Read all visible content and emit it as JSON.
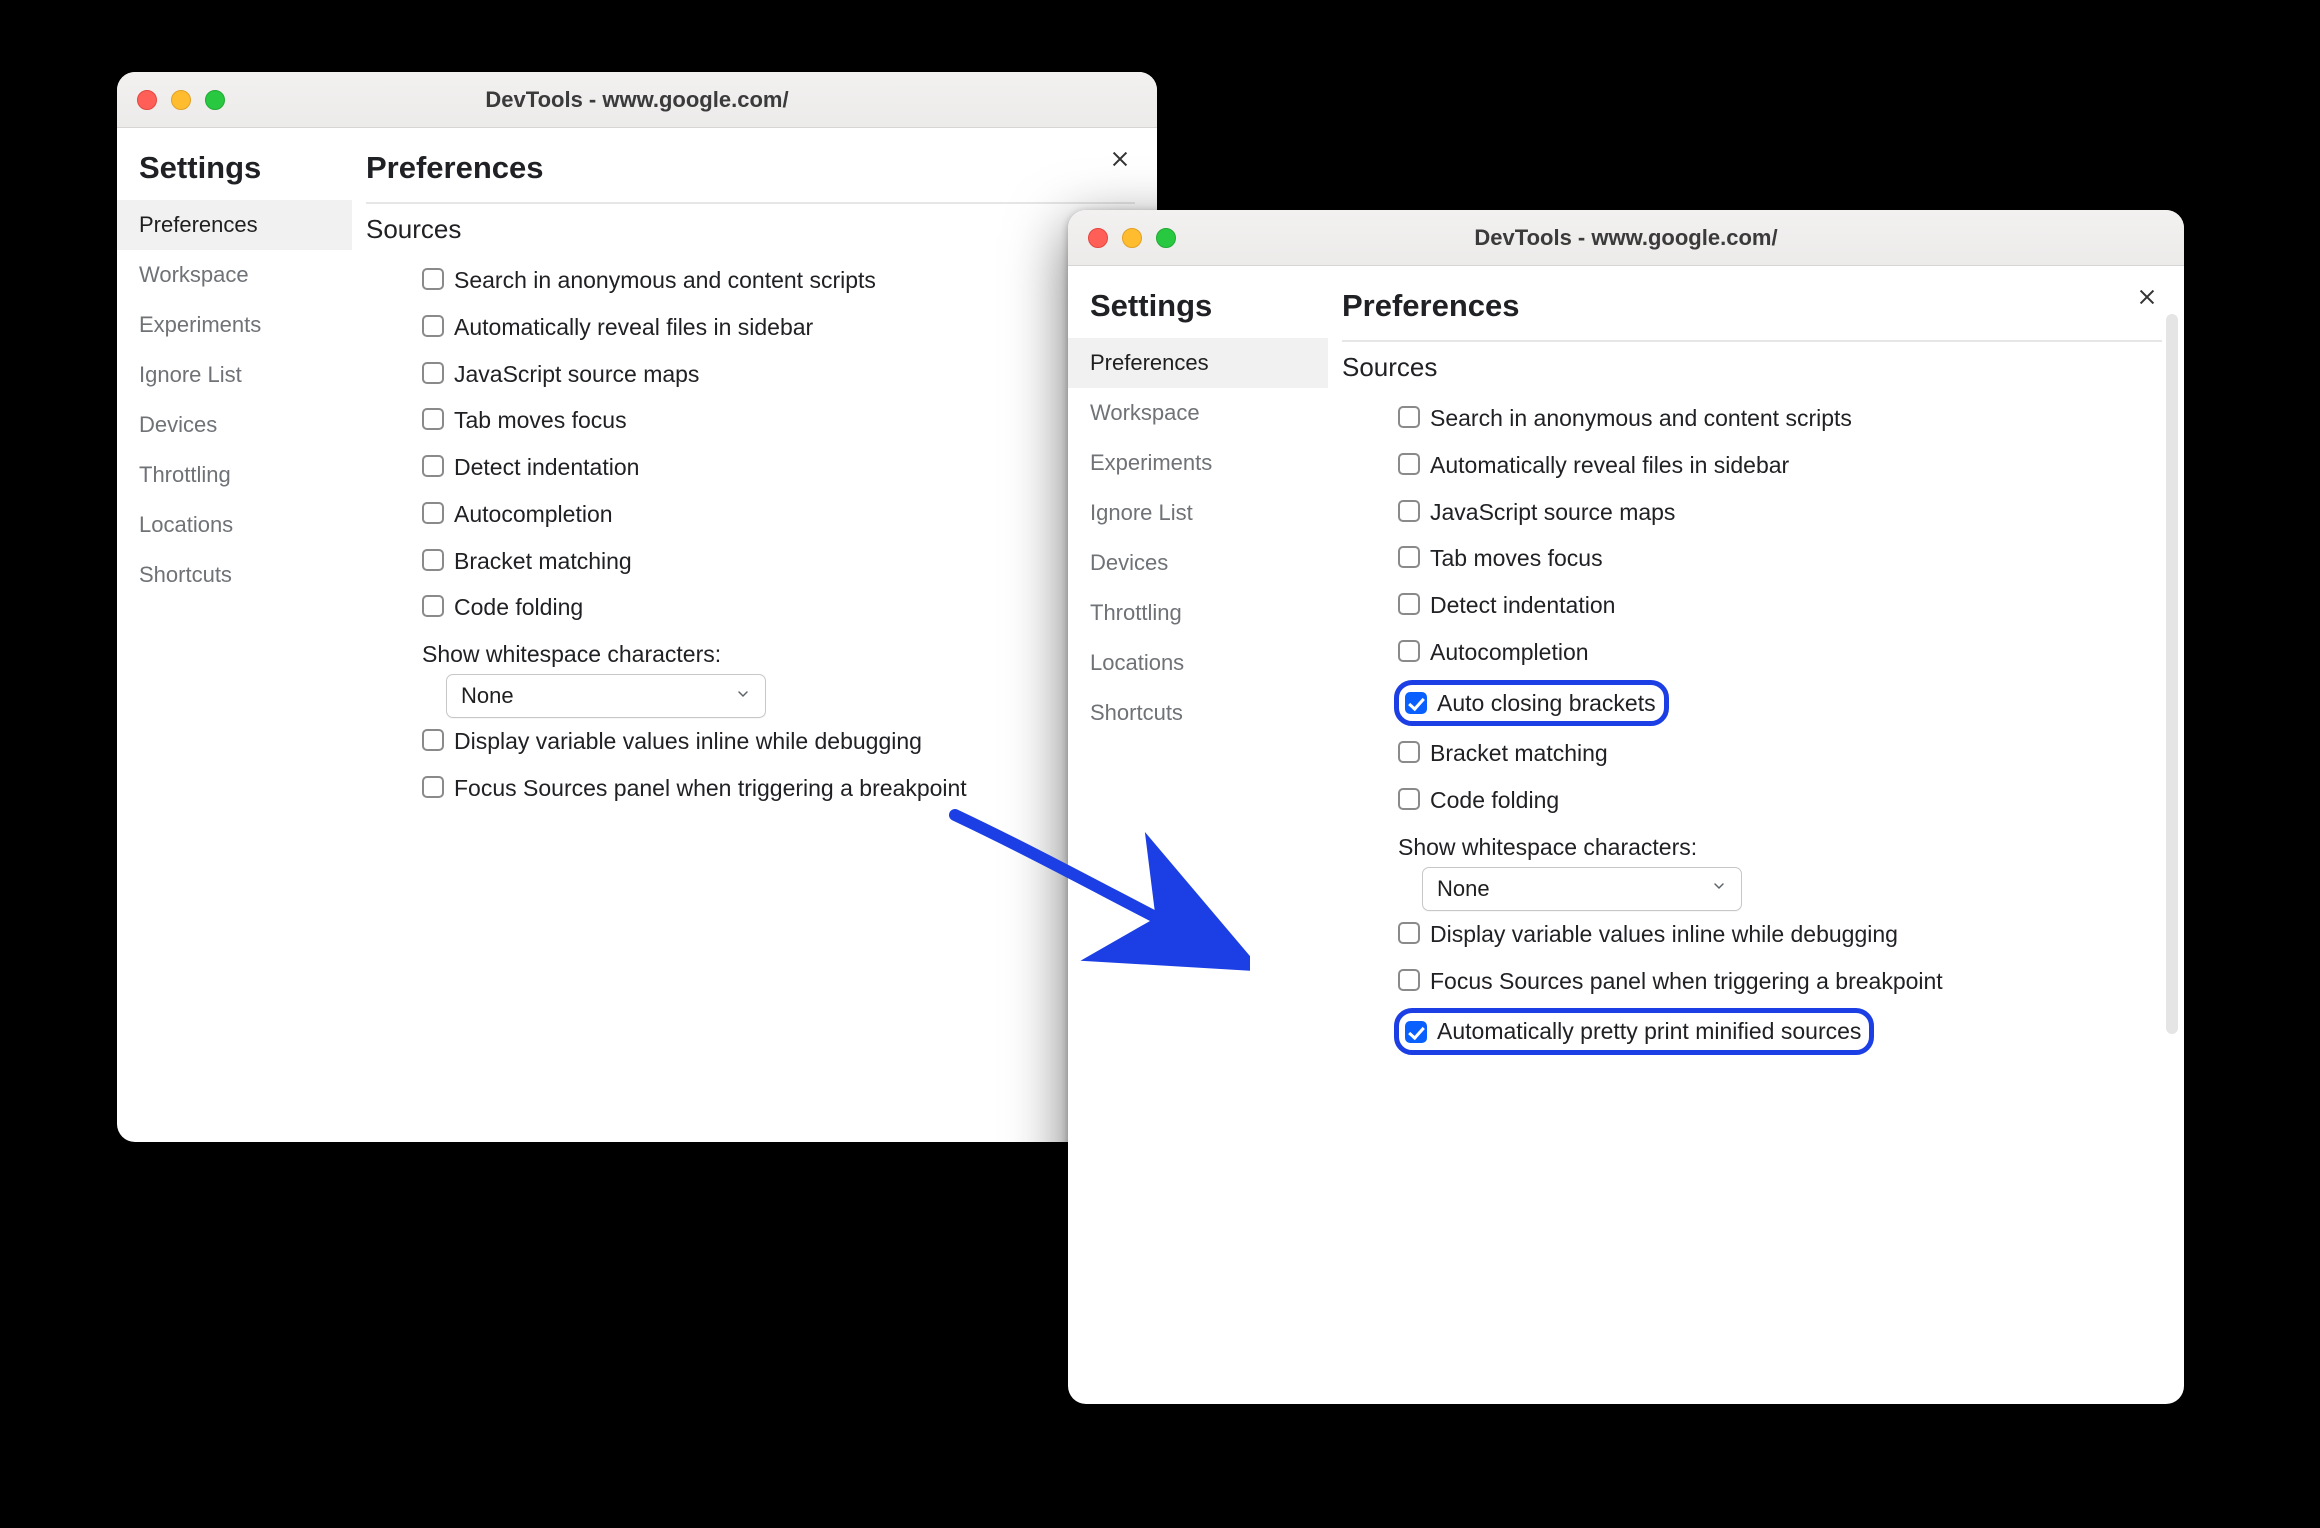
{
  "colors": {
    "highlight": "#1b3fe4",
    "checkbox_checked": "#0a60ff"
  },
  "windows": {
    "left": {
      "title": "DevTools - www.google.com/",
      "settings_heading": "Settings",
      "main_heading": "Preferences",
      "section_heading": "Sources",
      "sidebar": [
        "Preferences",
        "Workspace",
        "Experiments",
        "Ignore List",
        "Devices",
        "Throttling",
        "Locations",
        "Shortcuts"
      ],
      "sidebar_active_index": 0,
      "options": [
        {
          "label": "Search in anonymous and content scripts",
          "checked": false
        },
        {
          "label": "Automatically reveal files in sidebar",
          "checked": false
        },
        {
          "label": "JavaScript source maps",
          "checked": false
        },
        {
          "label": "Tab moves focus",
          "checked": false
        },
        {
          "label": "Detect indentation",
          "checked": false
        },
        {
          "label": "Autocompletion",
          "checked": false
        },
        {
          "label": "Bracket matching",
          "checked": false
        },
        {
          "label": "Code folding",
          "checked": false
        }
      ],
      "whitespace_label": "Show whitespace characters:",
      "whitespace_value": "None",
      "tail_options": [
        {
          "label": "Display variable values inline while debugging",
          "checked": false
        },
        {
          "label": "Focus Sources panel when triggering a breakpoint",
          "checked": false
        }
      ]
    },
    "right": {
      "title": "DevTools - www.google.com/",
      "settings_heading": "Settings",
      "main_heading": "Preferences",
      "section_heading": "Sources",
      "sidebar": [
        "Preferences",
        "Workspace",
        "Experiments",
        "Ignore List",
        "Devices",
        "Throttling",
        "Locations",
        "Shortcuts"
      ],
      "sidebar_active_index": 0,
      "options": [
        {
          "label": "Search in anonymous and content scripts",
          "checked": false,
          "highlighted": false
        },
        {
          "label": "Automatically reveal files in sidebar",
          "checked": false,
          "highlighted": false
        },
        {
          "label": "JavaScript source maps",
          "checked": false,
          "highlighted": false
        },
        {
          "label": "Tab moves focus",
          "checked": false,
          "highlighted": false
        },
        {
          "label": "Detect indentation",
          "checked": false,
          "highlighted": false
        },
        {
          "label": "Autocompletion",
          "checked": false,
          "highlighted": false
        },
        {
          "label": "Auto closing brackets",
          "checked": true,
          "highlighted": true
        },
        {
          "label": "Bracket matching",
          "checked": false,
          "highlighted": false
        },
        {
          "label": "Code folding",
          "checked": false,
          "highlighted": false
        }
      ],
      "whitespace_label": "Show whitespace characters:",
      "whitespace_value": "None",
      "tail_options": [
        {
          "label": "Display variable values inline while debugging",
          "checked": false,
          "highlighted": false
        },
        {
          "label": "Focus Sources panel when triggering a breakpoint",
          "checked": false,
          "highlighted": false
        },
        {
          "label": "Automatically pretty print minified sources",
          "checked": true,
          "highlighted": true
        }
      ]
    }
  }
}
